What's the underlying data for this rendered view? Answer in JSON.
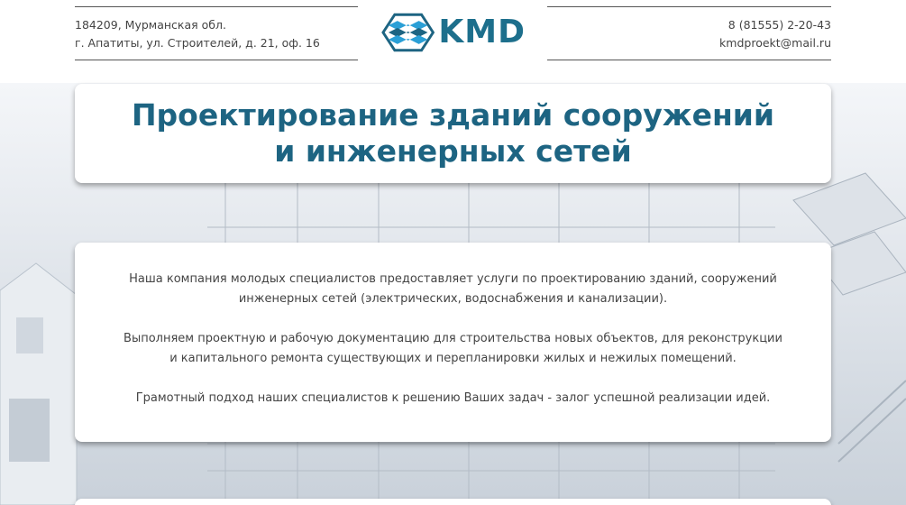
{
  "header": {
    "address_line1": "184209, Мурманская обл.",
    "address_line2": "г. Апатиты, ул. Строителей, д. 21, оф. 16",
    "phone": "8 (81555) 2-20-43",
    "email": "kmdproekt@mail.ru",
    "logo_text": "KMD"
  },
  "hero": {
    "title_line1": "Проектирование зданий сооружений",
    "title_line2": "и инженерных сетей"
  },
  "about": {
    "paragraph1_line1": "Наша компания молодых специалистов предоставляет услуги по проектированию зданий, сооружений",
    "paragraph1_line2": "инженерных сетей (электрических, водоснабжения и канализации).",
    "paragraph2_line1": "Выполняем проектную и рабочую документацию для строительства новых объектов, для реконструкции",
    "paragraph2_line2": "и капитального ремонта существующих и перепланировки жилых и нежилых помещений.",
    "paragraph3": "Грамотный подход наших специалистов к решению Ваших задач - залог успешной реализации идей."
  },
  "colors": {
    "brand": "#1d6482",
    "logo_blue": "#2a9fd6"
  }
}
